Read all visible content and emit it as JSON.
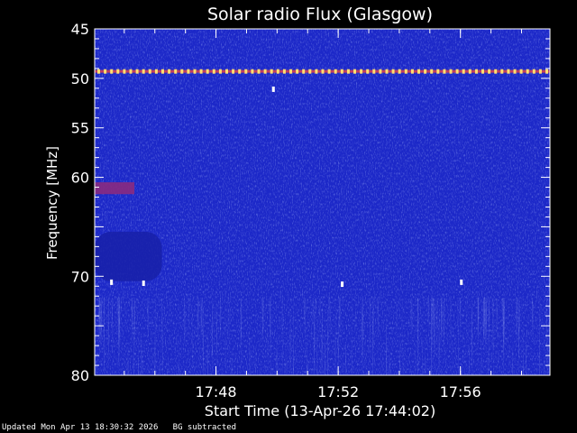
{
  "chart_data": {
    "type": "heatmap",
    "title": "Solar radio Flux (Glasgow)",
    "xlabel": "Start Time (13-Apr-26 17:44:02)",
    "ylabel": "Frequency [MHz]",
    "x_start_label": "17:44:02",
    "x_ticks": [
      {
        "label": "17:48",
        "minutes": 3.97
      },
      {
        "label": "17:52",
        "minutes": 7.97
      },
      {
        "label": "17:56",
        "minutes": 11.97
      }
    ],
    "xlim_minutes": [
      0,
      14.9
    ],
    "y_ticks": [
      45,
      50,
      55,
      60,
      65,
      70,
      75,
      80
    ],
    "y_tick_labels": [
      "45",
      "50",
      "55",
      "60",
      "",
      "70",
      "",
      "80"
    ],
    "ylim": [
      45,
      80
    ],
    "y_inverted": true,
    "background_color": "#1c28c8",
    "features": [
      {
        "kind": "periodic_interference",
        "freq_mhz": 49.3,
        "color": "#ffe070"
      },
      {
        "kind": "burst_patch",
        "freq_range_mhz": [
          60.5,
          61.7
        ],
        "time_range_minutes": [
          0,
          1.3
        ],
        "color": "#8a2a80"
      },
      {
        "kind": "dark_patch",
        "freq_range_mhz": [
          65.5,
          70.5
        ],
        "time_range_minutes": [
          0,
          2.2
        ],
        "color": "#1820a8"
      }
    ],
    "spots": [
      {
        "t": 5.85,
        "f": 51.1
      },
      {
        "t": 1.6,
        "f": 70.7
      },
      {
        "t": 8.1,
        "f": 70.8
      },
      {
        "t": 0.55,
        "f": 70.6
      },
      {
        "t": 12.0,
        "f": 70.6
      }
    ]
  },
  "footer": {
    "updated": "Updated Mon Apr 13 18:30:32 2026",
    "bg_note": "BG subtracted"
  }
}
